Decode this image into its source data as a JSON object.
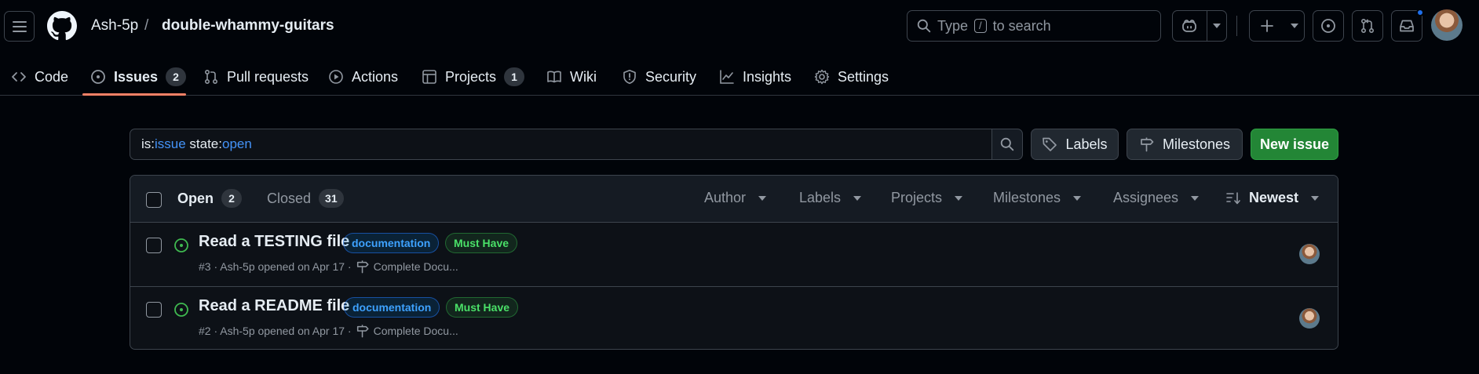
{
  "header": {
    "owner": "Ash-5p",
    "separator": "/",
    "repo": "double-whammy-guitars",
    "search_placeholder_pre": "Type",
    "search_key": "/",
    "search_placeholder_post": "to search",
    "notification_dot_color": "#1f6feb"
  },
  "tabs": [
    {
      "label": "Code",
      "icon": "code-icon"
    },
    {
      "label": "Issues",
      "icon": "issue-opened-icon",
      "count": "2",
      "selected": true
    },
    {
      "label": "Pull requests",
      "icon": "git-pull-request-icon"
    },
    {
      "label": "Actions",
      "icon": "play-icon"
    },
    {
      "label": "Projects",
      "icon": "table-icon",
      "count": "1"
    },
    {
      "label": "Wiki",
      "icon": "book-icon"
    },
    {
      "label": "Security",
      "icon": "shield-icon"
    },
    {
      "label": "Insights",
      "icon": "graph-icon"
    },
    {
      "label": "Settings",
      "icon": "gear-icon"
    }
  ],
  "filter": {
    "is_key": "is:",
    "is_value": "issue",
    "state_key": " state:",
    "state_value": "open",
    "labels_button": "Labels",
    "milestones_button": "Milestones",
    "new_issue_button": "New issue"
  },
  "list": {
    "open_label": "Open",
    "open_count": "2",
    "closed_label": "Closed",
    "closed_count": "31",
    "filters": [
      "Author",
      "Labels",
      "Projects",
      "Milestones",
      "Assignees"
    ],
    "sort_label": "Newest",
    "issues": [
      {
        "title": "Read a TESTING file",
        "labels": [
          "documentation",
          "Must Have"
        ],
        "meta": "#3 · Ash-5p opened on Apr 17 ·",
        "milestone": "Complete Docu..."
      },
      {
        "title": "Read a README file",
        "labels": [
          "documentation",
          "Must Have"
        ],
        "meta": "#2 · Ash-5p opened on Apr 17 ·",
        "milestone": "Complete Docu..."
      }
    ]
  },
  "colors": {
    "accent_underline": "#f78166",
    "new_issue_green": "#238636",
    "open_issue_green": "#3fb950",
    "label_documentation": "#3ea2ff",
    "label_must_have": "#4ae168"
  }
}
